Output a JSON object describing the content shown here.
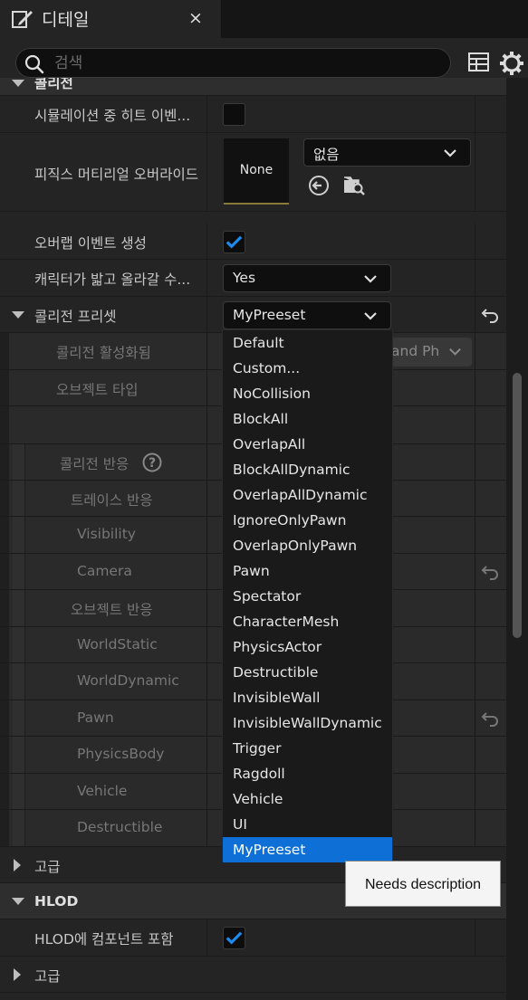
{
  "tab": {
    "title": "디테일",
    "close_label": "×"
  },
  "search": {
    "placeholder": "검색"
  },
  "section_top_label": "콜리전",
  "rows": {
    "sim_hit_events": "시뮬레이션 중 히트 이벤...",
    "phys_material_override": "피직스 머티리얼 오버라이드",
    "phys_material_thumb": "None",
    "phys_material_combo": "없음",
    "gen_overlap_events": "오버랩 이벤트 생성",
    "can_step_up": "캐릭터가 밟고 올라갈 수...",
    "can_step_up_value": "Yes",
    "collision_presets": "콜리전 프리셋",
    "collision_presets_value": "MyPreeset",
    "collision_enabled": "콜리전 활성화됨",
    "collision_enabled_value": "and Ph",
    "object_type": "오브젝트 타입",
    "collision_responses": "콜리전 반응",
    "trace_responses": "트레이스 반응",
    "visibility": "Visibility",
    "camera": "Camera",
    "object_responses": "오브젝트 반응",
    "world_static": "WorldStatic",
    "world_dynamic": "WorldDynamic",
    "pawn": "Pawn",
    "physics_body": "PhysicsBody",
    "vehicle": "Vehicle",
    "destructible": "Destructible",
    "advanced_1": "고급",
    "hlod_section": "HLOD",
    "hlod_include": "HLOD에 컴포넌트 포함",
    "advanced_2": "고급"
  },
  "checkbox_states": {
    "sim_hit_events": false,
    "gen_overlap_events": true,
    "hlod_include": true
  },
  "dropdown": {
    "items": [
      "Default",
      "Custom...",
      "NoCollision",
      "BlockAll",
      "OverlapAll",
      "BlockAllDynamic",
      "OverlapAllDynamic",
      "IgnoreOnlyPawn",
      "OverlapOnlyPawn",
      "Pawn",
      "Spectator",
      "CharacterMesh",
      "PhysicsActor",
      "Destructible",
      "InvisibleWall",
      "InvisibleWallDynamic",
      "Trigger",
      "Ragdoll",
      "Vehicle",
      "UI",
      "MyPreeset"
    ],
    "selected": "MyPreeset"
  },
  "tooltip": "Needs description",
  "colors": {
    "accent": "#0e70d6",
    "panel": "#242424",
    "background": "#151515"
  }
}
